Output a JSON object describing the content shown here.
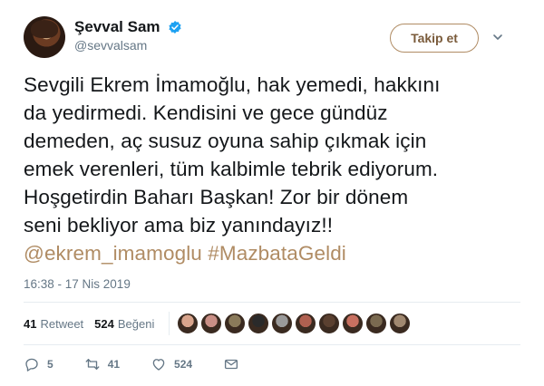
{
  "user": {
    "display_name": "Şevval Sam",
    "handle": "@sevvalsam",
    "verified": true
  },
  "follow_button": {
    "label": "Takip et"
  },
  "tweet": {
    "lines": [
      "Sevgili Ekrem İmamoğlu, hak yemedi, hakkını",
      "da yedirmedi. Kendisini ve gece gündüz",
      "demeden, aç susuz oyuna sahip çıkmak için",
      "emek verenleri, tüm kalbimle tebrik ediyorum.",
      "Hoşgetirdin Baharı Başkan! Zor bir dönem",
      "seni bekliyor ama biz yanındayız!!"
    ],
    "mention": "@ekrem_imamoglu",
    "hashtag": "#MazbataGeldi",
    "timestamp": "16:38 - 17 Nis 2019"
  },
  "stats": {
    "retweets_count": "41",
    "retweets_label": "Retweet",
    "likes_count": "524",
    "likes_label": "Beğeni"
  },
  "likers": [
    {
      "icon": "avatar",
      "color": "#d8a48c"
    },
    {
      "icon": "avatar",
      "color": "#c98f86"
    },
    {
      "icon": "avatar",
      "color": "#8a7a5a"
    },
    {
      "icon": "avatar",
      "color": "#2a2a2a"
    },
    {
      "icon": "avatar",
      "color": "#9a9a9a"
    },
    {
      "icon": "avatar",
      "color": "#b06050"
    },
    {
      "icon": "avatar",
      "color": "#5a4030"
    },
    {
      "icon": "avatar",
      "color": "#c87060"
    },
    {
      "icon": "avatar",
      "color": "#7a6a50"
    },
    {
      "icon": "avatar",
      "color": "#a08870"
    }
  ],
  "actions": {
    "reply_count": "5",
    "retweet_count": "41",
    "like_count": "524"
  },
  "colors": {
    "accent": "#b08c64",
    "verified": "#1da1f2",
    "muted": "#657786"
  }
}
